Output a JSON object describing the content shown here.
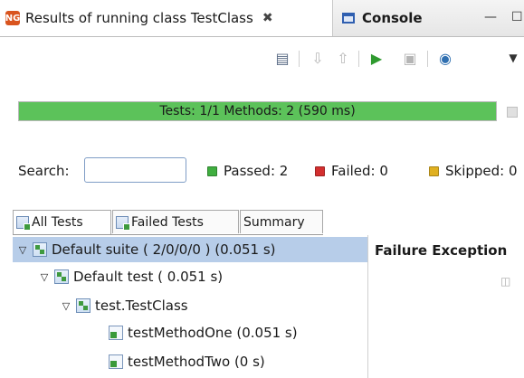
{
  "tabs": {
    "active_label": "Results of running class TestClass",
    "console_label": "Console"
  },
  "progress": {
    "text": "Tests: 1/1  Methods: 2 (590 ms)",
    "fraction": 1.0,
    "color": "#5cc25a"
  },
  "filter": {
    "search_label": "Search:",
    "search_value": "",
    "passed": "Passed: 2",
    "failed": "Failed: 0",
    "skipped": "Skipped: 0",
    "passed_color": "#3fae3f",
    "failed_color": "#d32f2f",
    "skipped_color": "#e0b020"
  },
  "subtabs": {
    "all": "All Tests",
    "failed": "Failed Tests",
    "summary": "Summary"
  },
  "tree": {
    "suite": "Default suite ( 2/0/0/0 ) (0.051 s)",
    "test": "Default test ( 0.051 s)",
    "class": "test.TestClass",
    "method_one": "testMethodOne  (0.051 s)",
    "method_two": "testMethodTwo  (0 s)"
  },
  "failure_panel": {
    "title": "Failure Exception"
  },
  "icons": {
    "tab_icon": "testng-icon",
    "console_icon": "console-icon",
    "toolbar": [
      "clear-results-icon",
      "next-failure-icon",
      "previous-failure-icon",
      "rerun-icon",
      "rerun-failed-icon",
      "globe-icon",
      "view-menu-icon"
    ]
  }
}
